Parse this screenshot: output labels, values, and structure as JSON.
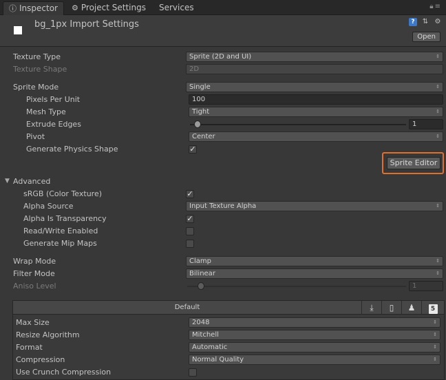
{
  "tabs": [
    {
      "label": "Inspector",
      "icon": "info-icon",
      "active": true
    },
    {
      "label": "Project Settings",
      "icon": "gear-icon",
      "active": false
    },
    {
      "label": "Services",
      "icon": "",
      "active": false
    }
  ],
  "header": {
    "title": "bg_1px Import Settings",
    "open_label": "Open"
  },
  "properties": {
    "texture_type": {
      "label": "Texture Type",
      "value": "Sprite (2D and UI)"
    },
    "texture_shape": {
      "label": "Texture Shape",
      "value": "2D"
    },
    "sprite_mode": {
      "label": "Sprite Mode",
      "value": "Single"
    },
    "pixels_per_unit": {
      "label": "Pixels Per Unit",
      "value": "100"
    },
    "mesh_type": {
      "label": "Mesh Type",
      "value": "Tight"
    },
    "extrude_edges": {
      "label": "Extrude Edges",
      "value": "1"
    },
    "pivot": {
      "label": "Pivot",
      "value": "Center"
    },
    "generate_physics_shape": {
      "label": "Generate Physics Shape",
      "checked": true
    },
    "sprite_editor_label": "Sprite Editor"
  },
  "advanced": {
    "label": "Advanced",
    "srgb": {
      "label": "sRGB (Color Texture)",
      "checked": true
    },
    "alpha_source": {
      "label": "Alpha Source",
      "value": "Input Texture Alpha"
    },
    "alpha_is_transparency": {
      "label": "Alpha Is Transparency",
      "checked": true
    },
    "read_write": {
      "label": "Read/Write Enabled",
      "checked": false
    },
    "generate_mip_maps": {
      "label": "Generate Mip Maps",
      "checked": false
    }
  },
  "sampling": {
    "wrap_mode": {
      "label": "Wrap Mode",
      "value": "Clamp"
    },
    "filter_mode": {
      "label": "Filter Mode",
      "value": "Bilinear"
    },
    "aniso_level": {
      "label": "Aniso Level",
      "value": "1"
    }
  },
  "platform": {
    "default_label": "Default",
    "icons": [
      "download-icon",
      "mobile-icon",
      "android-icon",
      "html5-icon"
    ],
    "html5_glyph": "5",
    "max_size": {
      "label": "Max Size",
      "value": "2048"
    },
    "resize_algorithm": {
      "label": "Resize Algorithm",
      "value": "Mitchell"
    },
    "format": {
      "label": "Format",
      "value": "Automatic"
    },
    "compression": {
      "label": "Compression",
      "value": "Normal Quality"
    },
    "use_crunch": {
      "label": "Use Crunch Compression",
      "checked": false
    }
  }
}
